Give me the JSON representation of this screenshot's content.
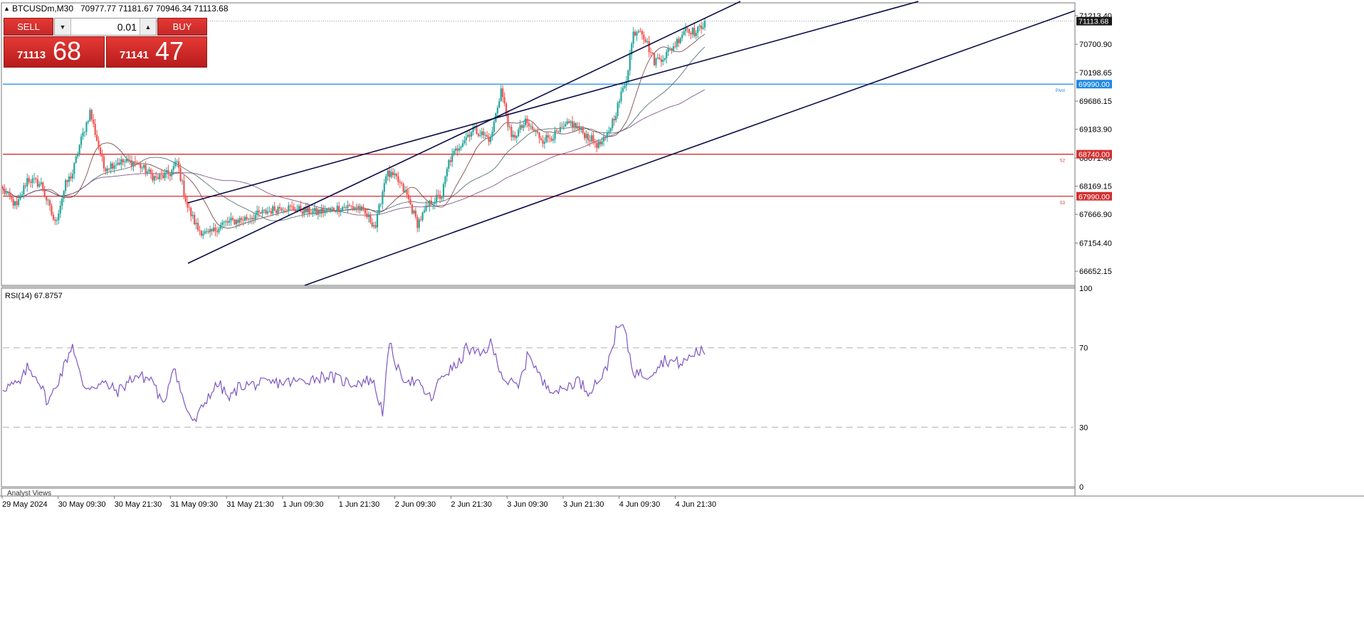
{
  "header": {
    "symbol": "BTCUSDm,M30",
    "ohlc": "70977.77 71181.67 70946.34 71113.68"
  },
  "trade_panel": {
    "sell_label": "SELL",
    "buy_label": "BUY",
    "lot_value": "0.01",
    "sell_price_small": "71113",
    "sell_price_big": "68",
    "buy_price_small": "71141",
    "buy_price_big": "47"
  },
  "colors": {
    "bull_candle": "#26a69a",
    "bear_candle": "#ef5350",
    "channel": "#0b0b4a",
    "pivot": "#1e88e5",
    "support": "#d32f2f",
    "rsi": "#7e57c2"
  },
  "chart_data": [
    {
      "type": "candlestick",
      "title": "",
      "interval": "M30",
      "x_ticks": [
        "29 May 2024",
        "30 May 09:30",
        "30 May 21:30",
        "31 May 09:30",
        "31 May 21:30",
        "1 Jun 09:30",
        "1 Jun 21:30",
        "2 Jun 09:30",
        "2 Jun 21:30",
        "3 Jun 09:30",
        "3 Jun 21:30",
        "4 Jun 09:30",
        "4 Jun 21:30"
      ],
      "y_ticks": [
        "71213.40",
        "70700.90",
        "70198.65",
        "69686.15",
        "69183.90",
        "68671.40",
        "68169.15",
        "67666.90",
        "67154.40",
        "66652.15"
      ],
      "ylim": [
        66400,
        71440
      ],
      "current_price": 71113.68,
      "current_price_label": "71113.68",
      "close_path": [
        [
          0,
          68100
        ],
        [
          8,
          67800
        ],
        [
          14,
          68300
        ],
        [
          22,
          68200
        ],
        [
          30,
          67500
        ],
        [
          36,
          68200
        ],
        [
          40,
          68400
        ],
        [
          44,
          68900
        ],
        [
          50,
          69500
        ],
        [
          58,
          68500
        ],
        [
          66,
          68600
        ],
        [
          76,
          68600
        ],
        [
          88,
          68300
        ],
        [
          96,
          68400
        ],
        [
          100,
          68600
        ],
        [
          106,
          67800
        ],
        [
          112,
          67400
        ],
        [
          118,
          67300
        ],
        [
          126,
          67500
        ],
        [
          140,
          67600
        ],
        [
          160,
          67800
        ],
        [
          180,
          67700
        ],
        [
          196,
          67800
        ],
        [
          204,
          67800
        ],
        [
          210,
          67600
        ],
        [
          214,
          67450
        ],
        [
          220,
          68400
        ],
        [
          226,
          68300
        ],
        [
          232,
          68000
        ],
        [
          238,
          67500
        ],
        [
          246,
          67900
        ],
        [
          252,
          68000
        ],
        [
          256,
          68600
        ],
        [
          262,
          68900
        ],
        [
          270,
          69200
        ],
        [
          280,
          69000
        ],
        [
          286,
          69900
        ],
        [
          292,
          69000
        ],
        [
          300,
          69300
        ],
        [
          310,
          69000
        ],
        [
          318,
          69100
        ],
        [
          326,
          69300
        ],
        [
          334,
          69100
        ],
        [
          342,
          68900
        ],
        [
          346,
          69000
        ],
        [
          352,
          69500
        ],
        [
          358,
          70100
        ],
        [
          362,
          70900
        ],
        [
          366,
          71000
        ],
        [
          370,
          70700
        ],
        [
          374,
          70400
        ],
        [
          380,
          70500
        ],
        [
          386,
          70700
        ],
        [
          392,
          71000
        ],
        [
          398,
          70900
        ],
        [
          403,
          71113.68
        ]
      ],
      "h_levels": [
        {
          "value": 69990.0,
          "label": "69990.00",
          "tag": "Pivot",
          "color": "#1e88e5"
        },
        {
          "value": 68740.0,
          "label": "68740.00",
          "tag": "S2",
          "color": "#d32f2f"
        },
        {
          "value": 67990.0,
          "label": "67990.00",
          "tag": "S3",
          "color": "#d32f2f"
        }
      ]
    },
    {
      "type": "line",
      "title": "RSI(14) 67.8757",
      "ylim": [
        0,
        100
      ],
      "y_ticks": [
        "100",
        "70",
        "30",
        "0"
      ],
      "levels": [
        70,
        30
      ],
      "values": [
        [
          0,
          50
        ],
        [
          10,
          52
        ],
        [
          14,
          60
        ],
        [
          20,
          55
        ],
        [
          26,
          42
        ],
        [
          34,
          58
        ],
        [
          40,
          72
        ],
        [
          46,
          50
        ],
        [
          58,
          52
        ],
        [
          66,
          48
        ],
        [
          76,
          56
        ],
        [
          86,
          54
        ],
        [
          92,
          40
        ],
        [
          98,
          62
        ],
        [
          104,
          42
        ],
        [
          110,
          32
        ],
        [
          118,
          46
        ],
        [
          124,
          52
        ],
        [
          130,
          44
        ],
        [
          136,
          51
        ],
        [
          150,
          52
        ],
        [
          170,
          53
        ],
        [
          186,
          56
        ],
        [
          200,
          52
        ],
        [
          212,
          54
        ],
        [
          218,
          38
        ],
        [
          222,
          72
        ],
        [
          228,
          56
        ],
        [
          238,
          52
        ],
        [
          246,
          44
        ],
        [
          252,
          56
        ],
        [
          262,
          62
        ],
        [
          266,
          70
        ],
        [
          274,
          66
        ],
        [
          280,
          72
        ],
        [
          288,
          54
        ],
        [
          296,
          50
        ],
        [
          302,
          68
        ],
        [
          310,
          52
        ],
        [
          320,
          48
        ],
        [
          330,
          54
        ],
        [
          336,
          48
        ],
        [
          346,
          58
        ],
        [
          352,
          78
        ],
        [
          356,
          82
        ],
        [
          362,
          58
        ],
        [
          370,
          56
        ],
        [
          380,
          64
        ],
        [
          390,
          62
        ],
        [
          398,
          68
        ]
      ]
    }
  ],
  "footer": {
    "analyst_views": "Analyst Views"
  }
}
